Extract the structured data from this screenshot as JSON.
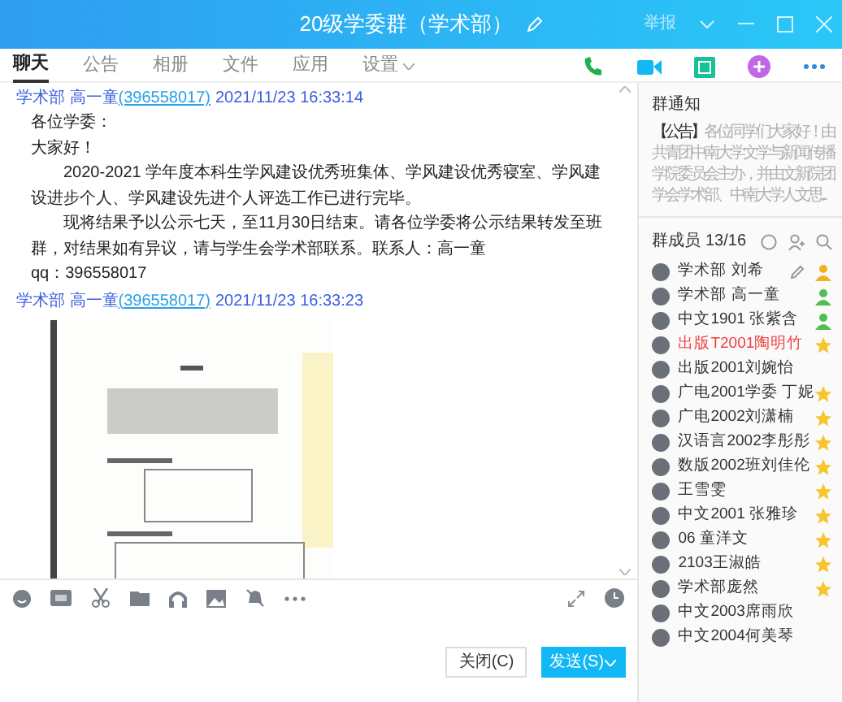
{
  "window": {
    "title": "20级学委群（学术部）",
    "report": "举报"
  },
  "tabs": [
    {
      "label": "聊天",
      "selected": true,
      "dropdown": false
    },
    {
      "label": "公告",
      "selected": false,
      "dropdown": false
    },
    {
      "label": "相册",
      "selected": false,
      "dropdown": false
    },
    {
      "label": "文件",
      "selected": false,
      "dropdown": false
    },
    {
      "label": "应用",
      "selected": false,
      "dropdown": false
    },
    {
      "label": "设置",
      "selected": false,
      "dropdown": true
    }
  ],
  "messages": [
    {
      "sender": "学术部 高一童",
      "qq": "(396558017)",
      "time": "2021/11/23 16:33:14",
      "kind": "text",
      "paragraphs": [
        {
          "text": "各位学委：",
          "indent": false
        },
        {
          "text": "大家好！",
          "indent": false
        },
        {
          "text": "2020-2021 学年度本科生学风建设优秀班集体、学风建设优秀寝室、学风建设进步个人、学风建设先进个人评选工作已进行完毕。",
          "indent": true
        },
        {
          "text": "现将结果予以公示七天，至11月30日结束。请各位学委将公示结果转发至班群，对结果如有异议，请与学生会学术部联系。联系人：高一童",
          "indent": true
        },
        {
          "text": "qq：396558017",
          "indent": false
        }
      ]
    },
    {
      "sender": "学术部 高一童",
      "qq": "(396558017)",
      "time": "2021/11/23 16:33:23",
      "kind": "picture"
    }
  ],
  "notice": {
    "title": "群通知",
    "tag": "【公告】",
    "text": "各位同学们大家好！由共青团中南大学文学与新闻传播学院委员会主办，并由文新院团学会学术部、中南大学人文思..."
  },
  "members": {
    "title": "群成员 13/16",
    "items": [
      {
        "name": "学术部 刘希",
        "kind": "owner"
      },
      {
        "name": "学术部 高一童",
        "kind": "admin"
      },
      {
        "name": "中文1901 张紫含",
        "kind": "admin"
      },
      {
        "name": "出版T2001陶明竹",
        "kind": "star",
        "color": "#f04040"
      },
      {
        "name": "出版2001刘婉怡",
        "kind": "plain"
      },
      {
        "name": "广电2001学委 丁妮",
        "kind": "star"
      },
      {
        "name": "广电2002刘潇楠",
        "kind": "star"
      },
      {
        "name": "汉语言2002李彤彤",
        "kind": "star"
      },
      {
        "name": "数版2002班刘佳伦",
        "kind": "star"
      },
      {
        "name": "王雪雯",
        "kind": "star"
      },
      {
        "name": "中文2001 张雅珍",
        "kind": "star"
      },
      {
        "name": "06 童洋文",
        "kind": "star"
      },
      {
        "name": "2103王淑皓",
        "kind": "star"
      },
      {
        "name": "学术部庞然",
        "kind": "star"
      },
      {
        "name": "中文2003席雨欣",
        "kind": "plain"
      },
      {
        "name": "中文2004何美琴",
        "kind": "plain"
      }
    ]
  },
  "buttons": {
    "close": "关闭(C)",
    "send": "发送(S)"
  }
}
